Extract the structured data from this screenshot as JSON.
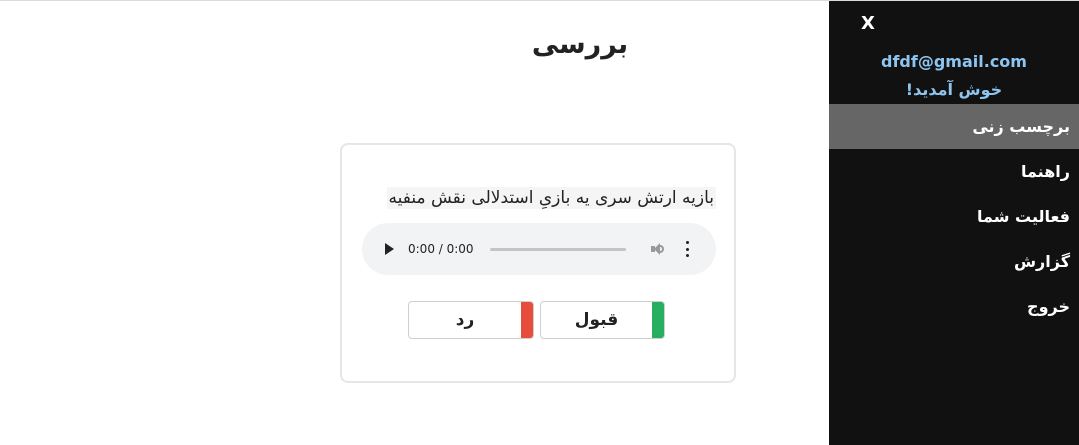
{
  "main": {
    "title": "بررسی",
    "card": {
      "sentence": "بازیه ارتش سری یه بازیِ استدلالی نقش منفیه",
      "audio": {
        "time": "0:00 / 0:00",
        "progress": 0
      },
      "accept_label": "قبول",
      "reject_label": "رد"
    }
  },
  "sidebar": {
    "close_label": "X",
    "email": "dfdf@gmail.com",
    "welcome": "خوش آمدید!",
    "items": [
      {
        "label": "برچسب زنی",
        "active": true
      },
      {
        "label": "راهنما",
        "active": false
      },
      {
        "label": "فعالیت شما",
        "active": false
      },
      {
        "label": "گزارش",
        "active": false
      },
      {
        "label": "خروج",
        "active": false
      }
    ]
  },
  "colors": {
    "accept": "#27ae60",
    "reject": "#e74c3c",
    "sidebar_bg": "#111111",
    "sidebar_active": "#666666",
    "sidebar_link": "#8ec5f0"
  }
}
